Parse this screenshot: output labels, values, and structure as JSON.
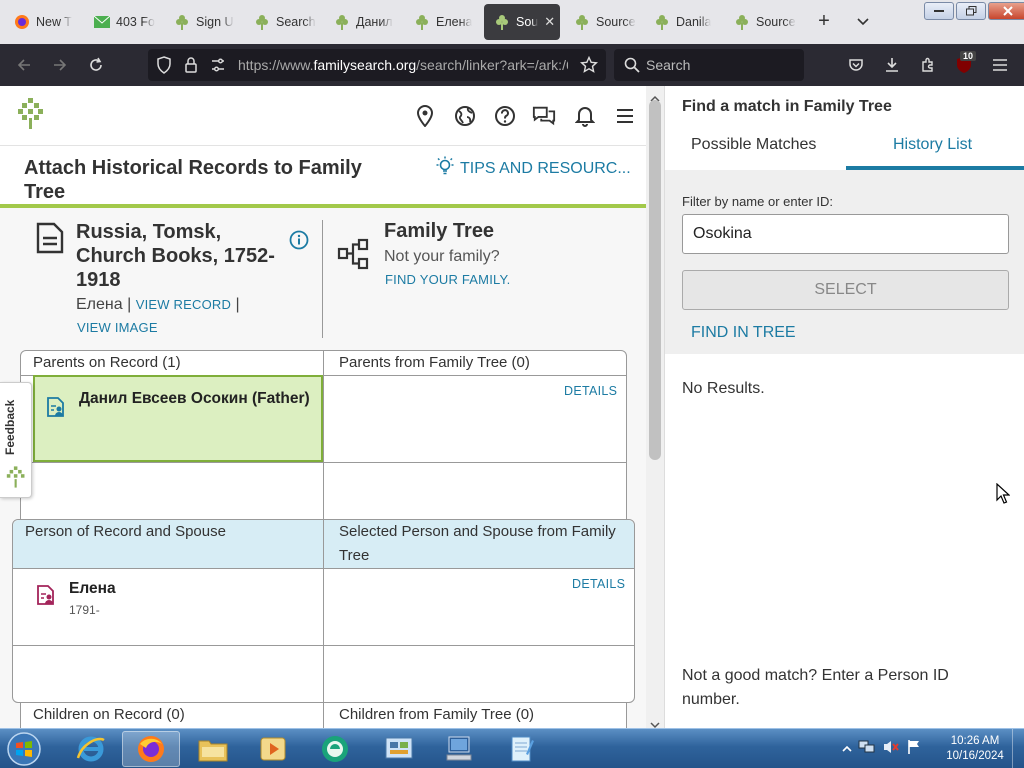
{
  "browser": {
    "tabs": [
      {
        "title": "New T",
        "icon": "firefox-icon"
      },
      {
        "title": "403 Fo",
        "icon": "mail-icon"
      },
      {
        "title": "Sign U",
        "icon": "familysearch-tree-icon"
      },
      {
        "title": "Search",
        "icon": "familysearch-tree-icon"
      },
      {
        "title": "Данил",
        "icon": "familysearch-tree-icon"
      },
      {
        "title": "Елена",
        "icon": "familysearch-tree-icon"
      },
      {
        "title": "Sou",
        "icon": "familysearch-tree-icon",
        "active": true
      },
      {
        "title": "Source",
        "icon": "familysearch-tree-icon"
      },
      {
        "title": "Danila",
        "icon": "familysearch-tree-icon"
      },
      {
        "title": "Source",
        "icon": "familysearch-tree-icon"
      }
    ],
    "new_tab": "+",
    "tab_close": "✕",
    "url_prefix": "https://www.",
    "url_host": "familysearch.org",
    "url_path": "/search/linker?ark=/ark:/6",
    "search_placeholder": "Search",
    "extension_badge": "10"
  },
  "header": {
    "title": "Attach Historical Records to Family Tree",
    "tips_label": "TIPS AND RESOURC..."
  },
  "record": {
    "title": "Russia, Tomsk, Church Books, 1752-1918",
    "person": "Елена",
    "sep": "|",
    "view_record": "VIEW RECORD",
    "view_image": "VIEW IMAGE"
  },
  "family_tree": {
    "title": "Family Tree",
    "subtitle": "Not your family?",
    "link": "FIND YOUR FAMILY."
  },
  "parents": {
    "record_header": "Parents on Record (1)",
    "tree_header": "Parents from Family Tree (0)",
    "father_name": "Данил Евсеев Осокин (Father)",
    "details": "DETAILS"
  },
  "persons": {
    "record_header": "Person of Record and Spouse",
    "tree_header": "Selected Person and Spouse from Family Tree",
    "name": "Елена",
    "dates": "1791-",
    "details": "DETAILS"
  },
  "children": {
    "record_header": "Children on Record (0)",
    "tree_header": "Children from Family Tree (0)"
  },
  "feedback_label": "Feedback",
  "panel": {
    "title": "Find a match in Family Tree",
    "tab_possible": "Possible Matches",
    "tab_history": "History List",
    "filter_label": "Filter by name or enter ID:",
    "filter_value": "Osokina",
    "select_label": "SELECT",
    "find_in_tree": "FIND IN TREE",
    "no_results": "No Results.",
    "not_good": "Not a good match? Enter a Person ID number."
  },
  "taskbar": {
    "time": "10:26 AM",
    "date": "10/16/2024"
  },
  "colors": {
    "link_blue": "#1c7ba3",
    "green_accent": "#a2c94a",
    "selected_green": "#dcefc1",
    "section_blue": "#d7edf5"
  }
}
